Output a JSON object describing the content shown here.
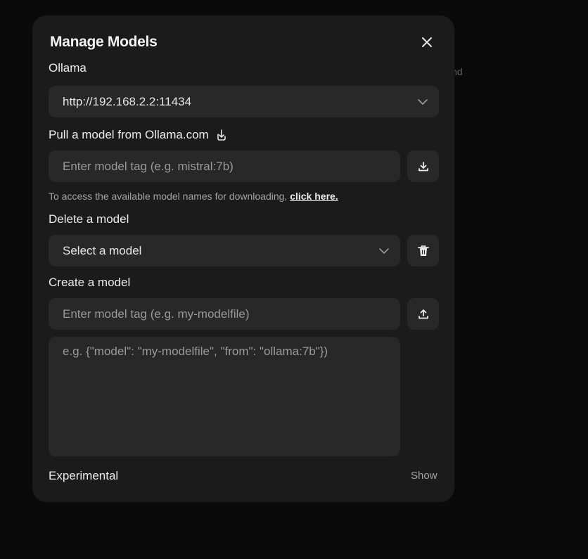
{
  "background": {
    "partial_text": "ound"
  },
  "modal": {
    "title": "Manage Models",
    "ollama": {
      "label": "Ollama",
      "selected_url": "http://192.168.2.2:11434"
    },
    "pull": {
      "label": "Pull a model from Ollama.com",
      "placeholder": "Enter model tag (e.g. mistral:7b)",
      "hint": "To access the available model names for downloading, ",
      "hint_link": "click here."
    },
    "delete": {
      "label": "Delete a model",
      "selected": "Select a model"
    },
    "create": {
      "label": "Create a model",
      "tag_placeholder": "Enter model tag (e.g. my-modelfile)",
      "json_placeholder": "e.g. {\"model\": \"my-modelfile\", \"from\": \"ollama:7b\"})"
    },
    "experimental": {
      "label": "Experimental",
      "toggle_label": "Show"
    }
  },
  "colors": {
    "page_bg": "#0a0a0a",
    "modal_bg": "#1b1b1b",
    "field_bg": "#282828"
  }
}
